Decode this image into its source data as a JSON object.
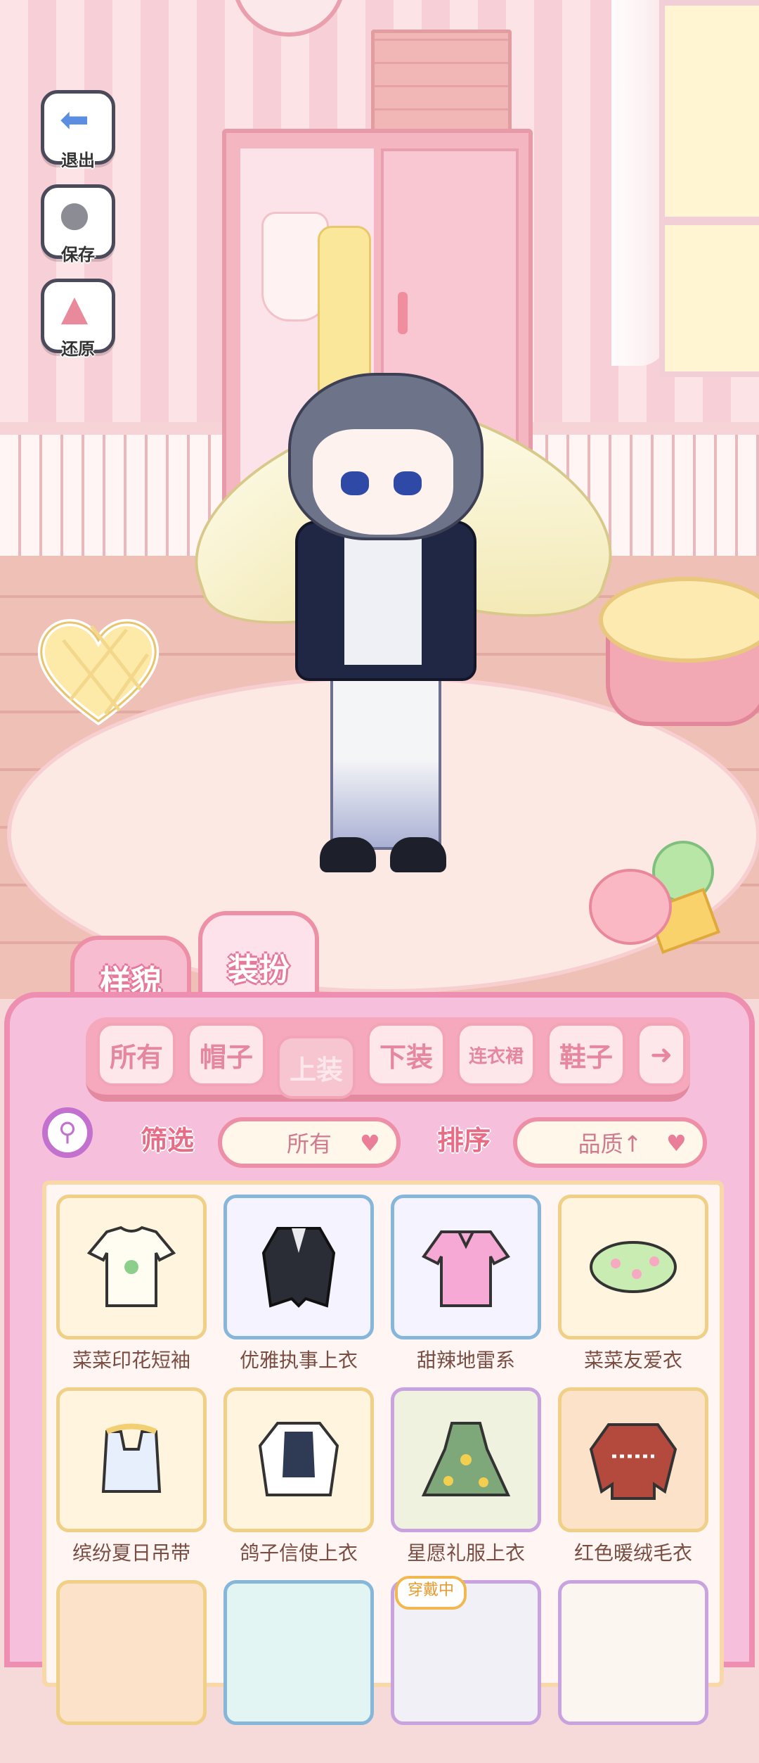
{
  "side_buttons": {
    "exit": "退出",
    "save": "保存",
    "restore": "还原"
  },
  "tabs": {
    "appearance": "样貌",
    "dressup": "装扮",
    "active": "装扮"
  },
  "categories": {
    "items": [
      "所有",
      "帽子",
      "上装",
      "下装",
      "连衣裙",
      "鞋子"
    ],
    "active": "上装"
  },
  "filter": {
    "label": "筛选",
    "value": "所有"
  },
  "sort": {
    "label": "排序",
    "value": "品质↑"
  },
  "items": [
    {
      "name": "菜菜印花短袖",
      "icon": "white-tshirt-icon"
    },
    {
      "name": "优雅执事上衣",
      "icon": "black-tailcoat-icon"
    },
    {
      "name": "甜辣地雷系",
      "icon": "pink-blouse-icon"
    },
    {
      "name": "菜菜友爱衣",
      "icon": "flower-garland-icon"
    },
    {
      "name": "缤纷夏日吊带",
      "icon": "summer-camisole-icon"
    },
    {
      "name": "鸽子信使上衣",
      "icon": "messenger-dress-icon"
    },
    {
      "name": "星愿礼服上衣",
      "icon": "green-gown-icon"
    },
    {
      "name": "红色暖绒毛衣",
      "icon": "red-sweater-icon"
    }
  ],
  "partial_row": {
    "wearing_badge": "穿戴中"
  },
  "colors": {
    "panel_bg": "#f6c0dc",
    "panel_border": "#ee8fb1",
    "accent_pink": "#e66d85",
    "item_name": "#7a4d43"
  }
}
